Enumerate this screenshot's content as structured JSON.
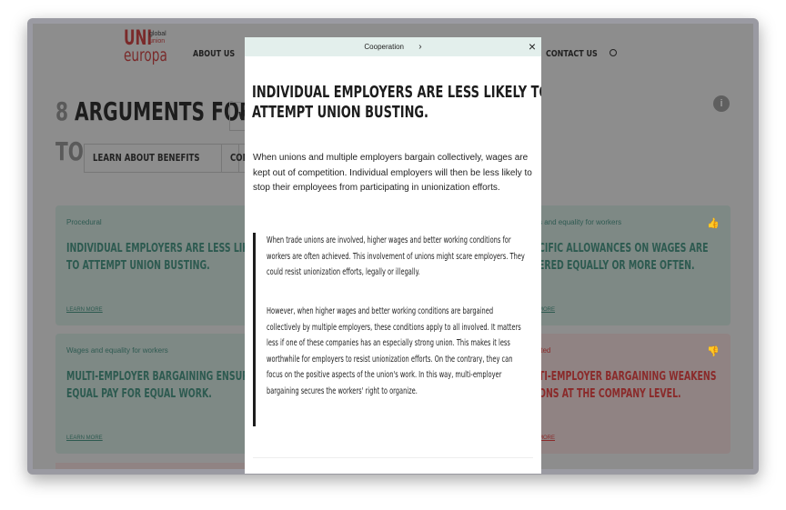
{
  "header": {
    "logo_top": "UNI",
    "logo_side1": "global",
    "logo_side2": "union",
    "logo_bottom": "europa",
    "nav": [
      "ABOUT US",
      "CONTACT US"
    ]
  },
  "hero": {
    "count": "8",
    "title": "ARGUMENTS FOR",
    "select_value": "W",
    "to": "TO",
    "buttons": [
      "LEARN ABOUT BENEFITS",
      "CONVINCE"
    ]
  },
  "cards": [
    {
      "category": "Procedural",
      "title1": "INDIVIDUAL EMPLOYERS ARE LESS LIKEL",
      "title2": "TO ATTEMPT UNION BUSTING.",
      "link": "LEARN MORE"
    },
    {
      "category": "Wages and equality for workers",
      "title1": "MULTI-EMPLOYER BARGAINING ENSURE",
      "title2": "EQUAL PAY FOR EQUAL WORK.",
      "link": "LEARN MORE"
    },
    {
      "category": "s and equality for workers",
      "title1": "CIFIC ALLOWANCES ON WAGES ARE",
      "title2": "ERED EQUALLY OR MORE OFTEN.",
      "link": "MORE"
    },
    {
      "category": "tted",
      "title1": "TI-EMPLOYER BARGAINING WEAKENS",
      "title2": "ONS AT THE COMPANY LEVEL.",
      "link": "MORE"
    }
  ],
  "modal": {
    "breadcrumb": "Cooperation",
    "title1": "INDIVIDUAL EMPLOYERS ARE LESS LIKELY TO",
    "title2": "ATTEMPT UNION BUSTING.",
    "intro": "When unions and multiple employers bargain collectively, wages are kept out of competition. Individual employers will then be less likely to stop their employees from participating in unionization efforts.",
    "quote1": "When trade unions are involved, higher wages and better working conditions for workers are often achieved. This involvement of unions might scare employers. They could resist unionization efforts, legally or illegally.",
    "quote2": "However, when higher wages and better working conditions are bargained collectively by multiple employers, these conditions apply to all involved. It matters less if one of these companies has an especially strong union. This makes it less worthwhile for employers to resist unionization efforts. On the contrary, they can focus on the positive aspects of the union's work. In this way, multi-employer bargaining secures the workers' right to organize."
  }
}
